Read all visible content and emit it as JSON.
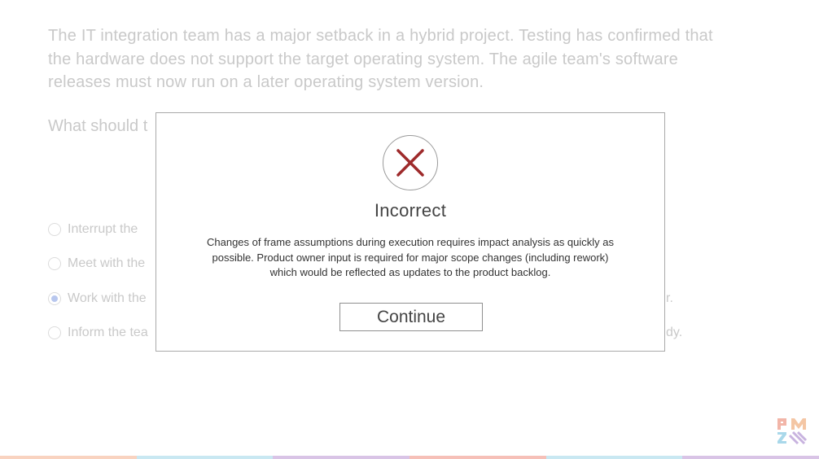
{
  "question": {
    "lines": [
      "The IT integration team has a major setback in a hybrid project. Testing has confirmed that",
      "the hardware does not support the target operating system.  The agile team's software",
      "releases must now run on a later operating system version."
    ],
    "prompt": "What should t"
  },
  "options": [
    {
      "label": "Interrupt the",
      "tail": "",
      "selected": false
    },
    {
      "label": "Meet with the",
      "tail": "",
      "selected": false
    },
    {
      "label": "Work with the",
      "tail": "r.",
      "selected": true
    },
    {
      "label": "Inform the tea",
      "tail": "dy.",
      "selected": false
    }
  ],
  "modal": {
    "icon": "x-mark-icon",
    "title": "Incorrect",
    "feedback_lines": [
      "Changes of frame assumptions during execution requires impact analysis as quickly as",
      "possible. Product owner input is required for major scope changes (including rework)",
      "which would be reflected as updates to the product backlog."
    ],
    "continue_label": "Continue",
    "icon_color": "#9e2a2b"
  },
  "logo": {
    "icon": "pmi-logo-icon"
  },
  "bottom_bar_colors": [
    "#f9d3c0",
    "#c9e8f2",
    "#d9c4e6",
    "#f6c0b8",
    "#c9e8f2",
    "#d9c4e6"
  ]
}
